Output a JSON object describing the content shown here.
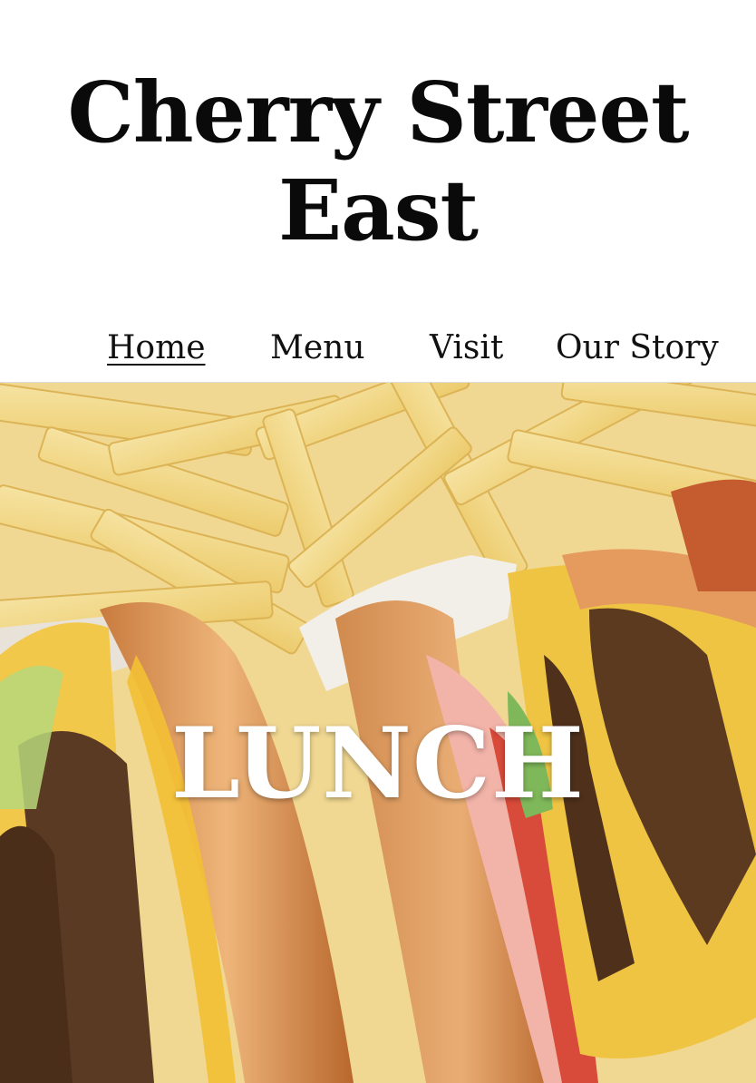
{
  "site": {
    "title": "Cherry Street East"
  },
  "nav": {
    "items": [
      {
        "label": "Home",
        "active": true
      },
      {
        "label": "Menu",
        "active": false
      },
      {
        "label": "Visit",
        "active": false
      },
      {
        "label": "Our Story",
        "active": false
      }
    ]
  },
  "hero": {
    "label": "LUNCH",
    "image_subject": "burgers-and-fries-photo"
  },
  "colors": {
    "background": "#ffffff",
    "text": "#111111",
    "hero_text": "#ffffff"
  }
}
